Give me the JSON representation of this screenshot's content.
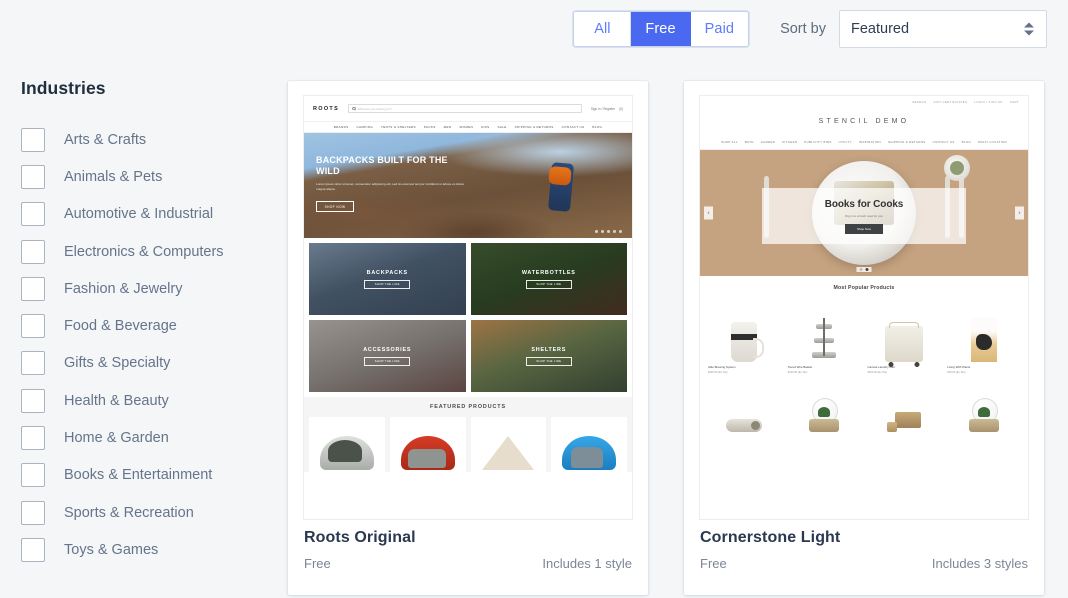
{
  "toolbar": {
    "filters": [
      {
        "label": "All",
        "active": false
      },
      {
        "label": "Free",
        "active": true
      },
      {
        "label": "Paid",
        "active": false
      }
    ],
    "sort_label": "Sort by",
    "sort_value": "Featured"
  },
  "sidebar": {
    "title": "Industries",
    "items": [
      {
        "label": "Arts & Crafts"
      },
      {
        "label": "Animals & Pets"
      },
      {
        "label": "Automotive & Industrial"
      },
      {
        "label": "Electronics & Computers"
      },
      {
        "label": "Fashion & Jewelry"
      },
      {
        "label": "Food & Beverage"
      },
      {
        "label": "Gifts & Specialty"
      },
      {
        "label": "Health & Beauty"
      },
      {
        "label": "Home & Garden"
      },
      {
        "label": "Books & Entertainment"
      },
      {
        "label": "Sports & Recreation"
      },
      {
        "label": "Toys & Games"
      }
    ]
  },
  "themes": [
    {
      "name": "Roots Original",
      "price": "Free",
      "styles": "Includes 1 style",
      "preview": {
        "logo": "ROOTS",
        "search_placeholder": "What are you looking for?",
        "account": "Sign in / Register",
        "cart": "(0)",
        "nav": [
          "BRANDS",
          "CAMPING",
          "TENTS & SHELTERS",
          "PACKS",
          "MEN",
          "WOMEN",
          "KIDS",
          "SALE",
          "SHIPPING & RETURNS",
          "CONTACT US",
          "BLOG"
        ],
        "hero_title": "BACKPACKS BUILT FOR THE WILD",
        "hero_sub": "Lorem ipsum dolor sit amet, consectetur adipiscing elit, sed do eiusmod tempor incididunt ut labore et dolore magna aliqua.",
        "hero_button": "SHOP NOW",
        "tiles": [
          {
            "label": "BACKPACKS",
            "button": "SHOP THE LINE"
          },
          {
            "label": "WATERBOTTLES",
            "button": "SHOP THE LINE"
          },
          {
            "label": "ACCESSORIES",
            "button": "SHOP THE LINE"
          },
          {
            "label": "SHELTERS",
            "button": "SHOP THE LINE"
          }
        ],
        "featured_title": "FEATURED PRODUCTS"
      }
    },
    {
      "name": "Cornerstone Light",
      "price": "Free",
      "styles": "Includes 3 styles",
      "preview": {
        "utility_nav": [
          "SEARCH",
          "GIFT CERTIFICATES",
          "LOGIN / SIGN UP",
          "CART"
        ],
        "brand": "STENCIL DEMO",
        "nav": [
          "SHOP ALL",
          "BATH",
          "GARDEN",
          "KITCHEN",
          "PUBLICITY BINS",
          "UTILITY",
          "INSPIRATION",
          "SHIPPING & RETURNS",
          "CONTACT US",
          "BLOG",
          "MULTI-LOCATION"
        ],
        "hero_title": "Books for Cooks",
        "hero_sub": "Dig in to a fresh read for you",
        "hero_button": "Shop Now",
        "prev_arrow": "‹",
        "next_arrow": "›",
        "popular_title": "Most Popular Products",
        "products": [
          {
            "name": "Able Brewing System",
            "price": "$225.00 (Ex Tax)"
          },
          {
            "name": "Tiered Wire Basket",
            "price": "$149.95 (Ex Tax)"
          },
          {
            "name": "Canvas Laundry Cart",
            "price": "$200.00 (Ex Tax)"
          },
          {
            "name": "Living With Plants",
            "price": "$18.00 (Ex Tax)"
          }
        ]
      }
    }
  ],
  "colors": {
    "accent": "#4a69f0",
    "accent_text": "#5c7cfa",
    "page_bg": "#f4f6f8",
    "card_bg": "#ffffff"
  }
}
